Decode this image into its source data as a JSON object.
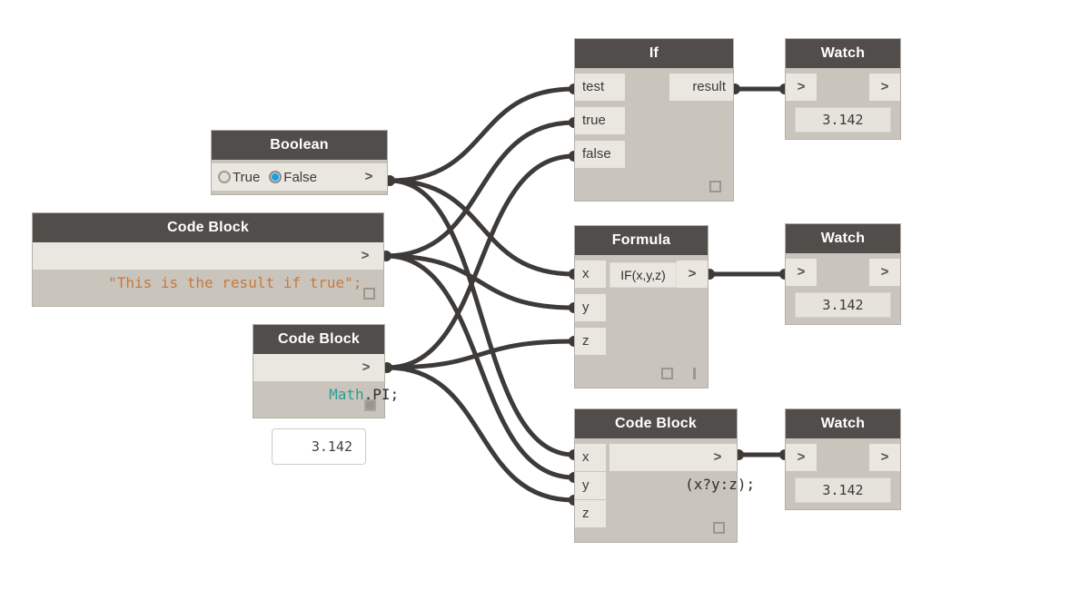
{
  "canvas": {
    "background": "#ffffff",
    "wire_color": "#3d3a38",
    "node_body_color": "#c9c5bd",
    "node_header_color": "#504d4a",
    "port_color": "#eae7e1",
    "accent_color": "#1b9fd8",
    "string_token_color": "#c8793d",
    "class_token_color": "#2c9c92"
  },
  "nodes": {
    "boolean": {
      "title": "Boolean",
      "options": [
        {
          "label": "True",
          "selected": false
        },
        {
          "label": "False",
          "selected": true
        }
      ],
      "output_glyph": ">"
    },
    "code_block_1": {
      "title": "Code Block",
      "code": "\"This is the result if true\";",
      "code_tokens": [
        {
          "text": "\"This is the result if true\";",
          "type": "string"
        }
      ],
      "output_glyph": ">",
      "bottom_icon": "square-outline"
    },
    "code_block_2": {
      "title": "Code Block",
      "code": "Math.PI;",
      "code_tokens": [
        {
          "text": "Math",
          "type": "class"
        },
        {
          "text": ".PI;",
          "type": "plain"
        }
      ],
      "output_glyph": ">",
      "bottom_icon": "square-filled",
      "preview_value": "3.142"
    },
    "if_node": {
      "title": "If",
      "inputs": [
        "test",
        "true",
        "false"
      ],
      "outputs": [
        "result"
      ],
      "bottom_icon": "square-outline"
    },
    "formula": {
      "title": "Formula",
      "inputs": [
        "x",
        "y",
        "z"
      ],
      "expression": "IF(x,y,z)",
      "output_glyph": ">",
      "bottom_icons": [
        "square-outline",
        "bar"
      ]
    },
    "code_block_3": {
      "title": "Code Block",
      "inputs": [
        "x",
        "y",
        "z"
      ],
      "code": "(x?y:z);",
      "code_tokens": [
        {
          "text": "(x?y:z);",
          "type": "plain"
        }
      ],
      "output_glyph": ">",
      "bottom_icon": "square-outline"
    },
    "watch_1": {
      "title": "Watch",
      "input_glyph": ">",
      "output_glyph": ">",
      "value": "3.142"
    },
    "watch_2": {
      "title": "Watch",
      "input_glyph": ">",
      "output_glyph": ">",
      "value": "3.142"
    },
    "watch_3": {
      "title": "Watch",
      "input_glyph": ">",
      "output_glyph": ">",
      "value": "3.142"
    }
  },
  "connections": [
    {
      "from": "boolean.out",
      "to": "if_node.test"
    },
    {
      "from": "boolean.out",
      "to": "formula.x"
    },
    {
      "from": "boolean.out",
      "to": "code_block_3.x"
    },
    {
      "from": "code_block_1.out",
      "to": "if_node.true"
    },
    {
      "from": "code_block_1.out",
      "to": "formula.y"
    },
    {
      "from": "code_block_1.out",
      "to": "code_block_3.y"
    },
    {
      "from": "code_block_2.out",
      "to": "if_node.false"
    },
    {
      "from": "code_block_2.out",
      "to": "formula.z"
    },
    {
      "from": "code_block_2.out",
      "to": "code_block_3.z"
    },
    {
      "from": "if_node.result",
      "to": "watch_1.in"
    },
    {
      "from": "formula.out",
      "to": "watch_2.in"
    },
    {
      "from": "code_block_3.out",
      "to": "watch_3.in"
    }
  ]
}
